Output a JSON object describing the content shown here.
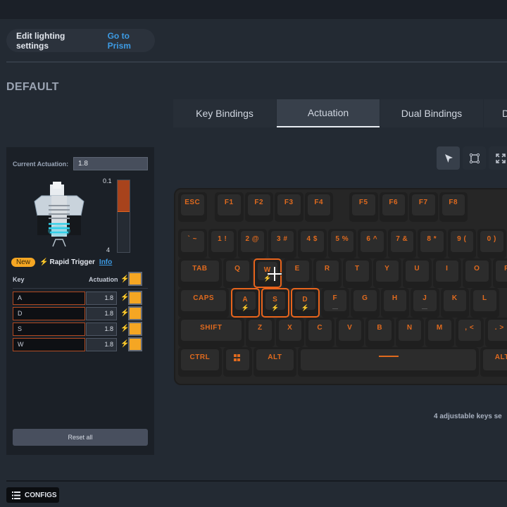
{
  "header": {
    "lighting_label": "Edit lighting settings",
    "lighting_link": "Go to Prism",
    "profile_title": "DEFAULT"
  },
  "tabs": [
    {
      "label": "Key Bindings",
      "active": false
    },
    {
      "label": "Actuation",
      "active": true
    },
    {
      "label": "Dual Bindings",
      "active": false
    },
    {
      "label": "D",
      "active": false
    }
  ],
  "tools": [
    {
      "name": "select-tool",
      "icon": "arrow-cursor-icon",
      "active": true
    },
    {
      "name": "box-select-tool",
      "icon": "bounding-box-icon",
      "active": false
    },
    {
      "name": "fullscreen-tool",
      "icon": "expand-icon",
      "active": false
    }
  ],
  "panel": {
    "current_actuation_label": "Current Actuation:",
    "current_actuation_value": "1.8",
    "scale_min": "0.1",
    "scale_max": "4",
    "actuation_fraction": 0.44,
    "new_badge": "New",
    "rapid_trigger_label": "Rapid Trigger",
    "info_link": "Info",
    "col_key": "Key",
    "col_actuation": "Actuation",
    "rows": [
      {
        "key": "A",
        "value": "1.8",
        "rapid": true
      },
      {
        "key": "D",
        "value": "1.8",
        "rapid": true
      },
      {
        "key": "S",
        "value": "1.8",
        "rapid": true
      },
      {
        "key": "W",
        "value": "1.8",
        "rapid": true
      }
    ],
    "reset_label": "Reset all"
  },
  "keyboard": {
    "selected_color": "#e8641c",
    "label_color": "#e06a1e",
    "keys": [
      {
        "id": "esc",
        "label": "ESC"
      },
      {
        "id": "f1",
        "label": "F1"
      },
      {
        "id": "f2",
        "label": "F2"
      },
      {
        "id": "f3",
        "label": "F3"
      },
      {
        "id": "f4",
        "label": "F4"
      },
      {
        "id": "f5",
        "label": "F5"
      },
      {
        "id": "f6",
        "label": "F6"
      },
      {
        "id": "f7",
        "label": "F7"
      },
      {
        "id": "f8",
        "label": "F8"
      },
      {
        "id": "grave",
        "label": "` ~"
      },
      {
        "id": "1",
        "label": "1 !"
      },
      {
        "id": "2",
        "label": "2 @"
      },
      {
        "id": "3",
        "label": "3 #"
      },
      {
        "id": "4",
        "label": "4 $"
      },
      {
        "id": "5",
        "label": "5 %"
      },
      {
        "id": "6",
        "label": "6 ^"
      },
      {
        "id": "7",
        "label": "7 &"
      },
      {
        "id": "8",
        "label": "8 *"
      },
      {
        "id": "9",
        "label": "9 ("
      },
      {
        "id": "0",
        "label": "0 )"
      },
      {
        "id": "tab",
        "label": "TAB"
      },
      {
        "id": "q",
        "label": "Q"
      },
      {
        "id": "w",
        "label": "W",
        "selected": true
      },
      {
        "id": "e",
        "label": "E"
      },
      {
        "id": "r",
        "label": "R"
      },
      {
        "id": "t",
        "label": "T"
      },
      {
        "id": "y",
        "label": "Y"
      },
      {
        "id": "u",
        "label": "U"
      },
      {
        "id": "i",
        "label": "I"
      },
      {
        "id": "o",
        "label": "O"
      },
      {
        "id": "p",
        "label": "P"
      },
      {
        "id": "caps",
        "label": "CAPS"
      },
      {
        "id": "a",
        "label": "A",
        "selected": true
      },
      {
        "id": "s",
        "label": "S",
        "selected": true
      },
      {
        "id": "d",
        "label": "D",
        "selected": true
      },
      {
        "id": "f",
        "label": "F"
      },
      {
        "id": "g",
        "label": "G"
      },
      {
        "id": "h",
        "label": "H"
      },
      {
        "id": "j",
        "label": "J"
      },
      {
        "id": "k",
        "label": "K"
      },
      {
        "id": "l",
        "label": "L"
      },
      {
        "id": "shift",
        "label": "SHIFT"
      },
      {
        "id": "z",
        "label": "Z"
      },
      {
        "id": "x",
        "label": "X"
      },
      {
        "id": "c",
        "label": "C"
      },
      {
        "id": "v",
        "label": "V"
      },
      {
        "id": "b",
        "label": "B"
      },
      {
        "id": "n",
        "label": "N"
      },
      {
        "id": "m",
        "label": "M"
      },
      {
        "id": "comma",
        "label": ", <"
      },
      {
        "id": "period",
        "label": ". >"
      },
      {
        "id": "ctrl",
        "label": "CTRL"
      },
      {
        "id": "win",
        "label": "",
        "icon": "windows-logo-icon"
      },
      {
        "id": "alt",
        "label": "ALT"
      },
      {
        "id": "space",
        "label": ""
      },
      {
        "id": "ralt",
        "label": "ALT"
      }
    ]
  },
  "status_text": "4 adjustable keys se",
  "footer": {
    "configs_label": "CONFIGS"
  }
}
